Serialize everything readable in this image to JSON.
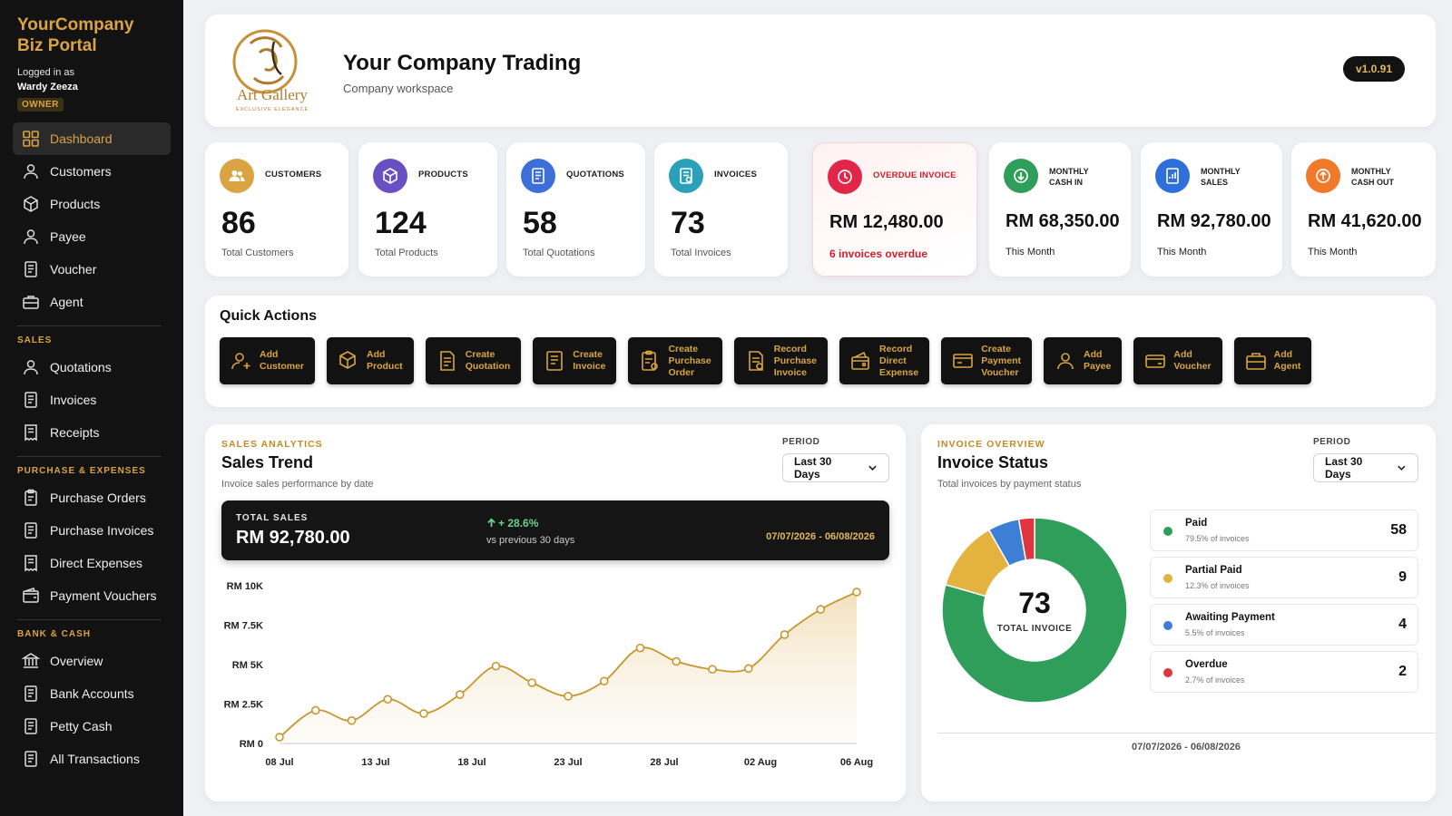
{
  "sidebar": {
    "brand_line1": "YourCompany",
    "brand_line2": "Biz Portal",
    "logged_in_label": "Logged in as",
    "user_name": "Wardy Zeeza",
    "role": "OWNER",
    "main_items": [
      {
        "label": "Dashboard",
        "icon": "grid-icon"
      },
      {
        "label": "Customers",
        "icon": "user-icon"
      },
      {
        "label": "Products",
        "icon": "box-icon"
      },
      {
        "label": "Payee",
        "icon": "user-icon"
      },
      {
        "label": "Voucher",
        "icon": "document-icon"
      },
      {
        "label": "Agent",
        "icon": "briefcase-icon"
      }
    ],
    "sales_header": "SALES",
    "sales_items": [
      {
        "label": "Quotations",
        "icon": "user-icon"
      },
      {
        "label": "Invoices",
        "icon": "document-icon"
      },
      {
        "label": "Receipts",
        "icon": "receipt-icon"
      }
    ],
    "purchase_header": "PURCHASE & EXPENSES",
    "purchase_items": [
      {
        "label": "Purchase Orders",
        "icon": "clipboard-icon"
      },
      {
        "label": "Purchase Invoices",
        "icon": "document-icon"
      },
      {
        "label": "Direct Expenses",
        "icon": "receipt-icon"
      },
      {
        "label": "Payment Vouchers",
        "icon": "wallet-icon"
      }
    ],
    "bank_header": "BANK & CASH",
    "bank_items": [
      {
        "label": "Overview",
        "icon": "bank-icon"
      },
      {
        "label": "Bank Accounts",
        "icon": "document-icon"
      },
      {
        "label": "Petty Cash",
        "icon": "document-icon"
      },
      {
        "label": "All Transactions",
        "icon": "document-icon"
      }
    ]
  },
  "header": {
    "logo_text": "Art Gallery",
    "logo_tagline": "EXCLUSIVE ELEGANCE",
    "title": "Your Company Trading",
    "subtitle": "Company workspace",
    "version": "v1.0.91"
  },
  "stats": {
    "customers": {
      "label": "CUSTOMERS",
      "value": "86",
      "foot": "Total Customers",
      "color": "#d9a441"
    },
    "products": {
      "label": "PRODUCTS",
      "value": "124",
      "foot": "Total Products",
      "color": "#6a4fc2"
    },
    "quotations": {
      "label": "QUOTATIONS",
      "value": "58",
      "foot": "Total Quotations",
      "color": "#3c6fd8"
    },
    "invoices": {
      "label": "INVOICES",
      "value": "73",
      "foot": "Total Invoices",
      "color": "#2aa1b8"
    },
    "overdue": {
      "label": "OVERDUE INVOICE",
      "value": "RM 12,480.00",
      "foot": "6 invoices overdue",
      "color": "#e2264a"
    },
    "cash_in": {
      "label_line1": "MONTHLY",
      "label_line2": "CASH IN",
      "value": "RM 68,350.00",
      "foot": "This Month",
      "color": "#2f9e5b"
    },
    "sales": {
      "label_line1": "MONTHLY",
      "label_line2": "SALES",
      "value": "RM 92,780.00",
      "foot": "This Month",
      "color": "#2f6fdb"
    },
    "cash_out": {
      "label_line1": "MONTHLY",
      "label_line2": "CASH OUT",
      "value": "RM 41,620.00",
      "foot": "This Month",
      "color": "#f07a2a"
    }
  },
  "quick_actions": {
    "title": "Quick Actions",
    "buttons": [
      {
        "line1": "Add",
        "line2": "Customer",
        "line3": "",
        "icon": "add-user-icon"
      },
      {
        "line1": "Add",
        "line2": "Product",
        "line3": "",
        "icon": "add-box-icon"
      },
      {
        "line1": "Create",
        "line2": "Quotation",
        "line3": "",
        "icon": "quotation-icon"
      },
      {
        "line1": "Create",
        "line2": "Invoice",
        "line3": "",
        "icon": "invoice-icon"
      },
      {
        "line1": "Create",
        "line2": "Purchase",
        "line3": "Order",
        "icon": "purchase-order-icon"
      },
      {
        "line1": "Record",
        "line2": "Purchase",
        "line3": "Invoice",
        "icon": "purchase-invoice-icon"
      },
      {
        "line1": "Record",
        "line2": "Direct",
        "line3": "Expense",
        "icon": "expense-icon"
      },
      {
        "line1": "Create",
        "line2": "Payment",
        "line3": "Voucher",
        "icon": "payment-voucher-icon"
      },
      {
        "line1": "Add",
        "line2": "Payee",
        "line3": "",
        "icon": "add-payee-icon"
      },
      {
        "line1": "Add",
        "line2": "Voucher",
        "line3": "",
        "icon": "voucher-icon"
      },
      {
        "line1": "Add",
        "line2": "Agent",
        "line3": "",
        "icon": "agent-icon"
      }
    ]
  },
  "sales_panel": {
    "overline": "SALES ANALYTICS",
    "title": "Sales Trend",
    "subtitle": "Invoice sales performance by date",
    "period_label": "PERIOD",
    "period_value": "Last 30 Days",
    "total_label": "TOTAL SALES",
    "total_value": "RM 92,780.00",
    "change": "+ 28.6%",
    "change_caption": "vs previous 30 days",
    "range": "07/07/2026 - 06/08/2026"
  },
  "invoice_panel": {
    "overline": "INVOICE OVERVIEW",
    "title": "Invoice Status",
    "subtitle": "Total invoices by payment status",
    "period_label": "PERIOD",
    "period_value": "Last 30 Days",
    "center_value": "73",
    "center_label": "TOTAL INVOICE",
    "range": "07/07/2026 - 06/08/2026",
    "statuses": [
      {
        "name": "Paid",
        "pct": "79.5% of invoices",
        "count": "58",
        "color": "#2f9e5b"
      },
      {
        "name": "Partial Paid",
        "pct": "12.3% of invoices",
        "count": "9",
        "color": "#e4b23e"
      },
      {
        "name": "Awaiting Payment",
        "pct": "5.5% of invoices",
        "count": "4",
        "color": "#3c7fd4"
      },
      {
        "name": "Overdue",
        "pct": "2.7% of invoices",
        "count": "2",
        "color": "#e0343e"
      }
    ]
  },
  "chart_data": [
    {
      "type": "area",
      "x": [
        "08 Jul",
        "10 Jul",
        "11 Jul",
        "13 Jul",
        "15 Jul",
        "17 Jul",
        "19 Jul",
        "21 Jul",
        "23 Jul",
        "25 Jul",
        "27 Jul",
        "29 Jul",
        "31 Jul",
        "02 Aug",
        "04 Aug",
        "05 Aug",
        "06 Aug"
      ],
      "xticks": [
        "08 Jul",
        "13 Jul",
        "18 Jul",
        "23 Jul",
        "28 Jul",
        "02 Aug",
        "06 Aug"
      ],
      "values": [
        400,
        2100,
        1450,
        2800,
        1900,
        3100,
        4900,
        3850,
        3000,
        3950,
        6050,
        5200,
        4700,
        4750,
        6900,
        8500,
        9600
      ],
      "yticks": [
        "RM 0",
        "RM 2.5K",
        "RM 5K",
        "RM 7.5K",
        "RM 10K"
      ],
      "ylim": [
        0,
        10000
      ],
      "line_color": "#c9962e"
    },
    {
      "type": "pie",
      "labels": [
        "Paid",
        "Partial Paid",
        "Awaiting Payment",
        "Overdue"
      ],
      "values": [
        58,
        9,
        4,
        2
      ],
      "colors": [
        "#2f9e5b",
        "#e4b23e",
        "#3c7fd4",
        "#e0343e"
      ]
    }
  ]
}
